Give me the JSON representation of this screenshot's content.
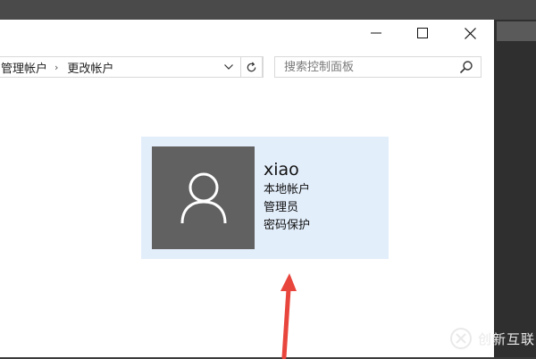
{
  "breadcrumb": {
    "items": [
      "管理帐户",
      "更改帐户"
    ],
    "separator": "›"
  },
  "search": {
    "placeholder": "搜索控制面板"
  },
  "window_controls": {
    "minimize": "minimize-icon",
    "maximize": "maximize-icon",
    "close": "close-icon"
  },
  "account": {
    "name": "xiao",
    "type": "本地帐户",
    "role": "管理员",
    "protection": "密码保护"
  },
  "watermark": {
    "text": "创新互联"
  },
  "colors": {
    "card_bg": "#e3eefb",
    "avatar_bg": "#616161",
    "arrow": "#e8453c"
  }
}
